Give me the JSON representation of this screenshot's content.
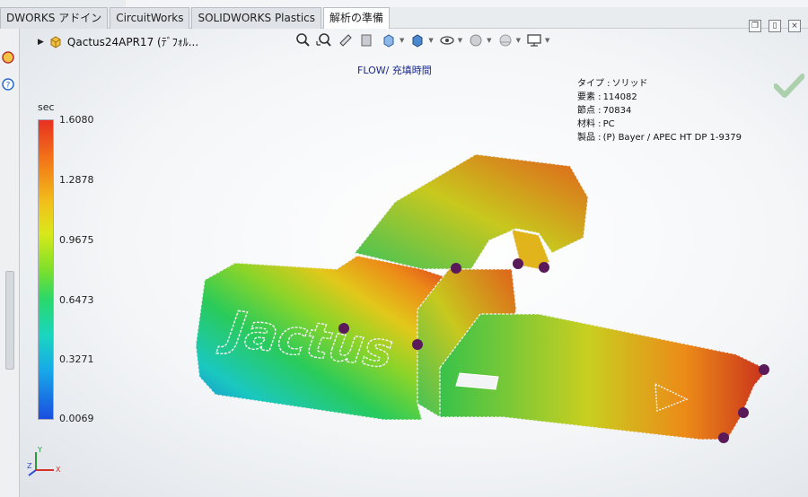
{
  "tabs": [
    {
      "label": "DWORKS アドイン",
      "active": false
    },
    {
      "label": "CircuitWorks",
      "active": false
    },
    {
      "label": "SOLIDWORKS Plastics",
      "active": false
    },
    {
      "label": "解析の準備",
      "active": true
    }
  ],
  "document": {
    "title": "Qactus24APR17 (ﾃﾞﾌｫﾙ..."
  },
  "plot": {
    "title": "FLOW/ 充填時間"
  },
  "info": {
    "type_label": "タイプ :",
    "type_value": "ソリッド",
    "elements_label": "要素 :",
    "elements_value": "114082",
    "nodes_label": "節点 :",
    "nodes_value": "70834",
    "material_label": "材料 :",
    "material_value": "PC",
    "product_label": "製品 :",
    "product_value": "(P)  Bayer / APEC HT DP 1-9379"
  },
  "legend": {
    "unit": "sec",
    "ticks": [
      "1.6080",
      "1.2878",
      "0.9675",
      "0.6473",
      "0.3271",
      "0.0069"
    ],
    "colors": {
      "max": "#e83020",
      "mid": "#7ee02a",
      "min": "#1a4ee0"
    }
  },
  "part": {
    "embossed_text": "Jactus"
  },
  "heads_up_toolbar": [
    "zoom-to-fit-icon",
    "zoom-to-area-icon",
    "previous-view-icon",
    "section-view-icon",
    "view-orientation-icon",
    "display-style-icon",
    "hide-show-items-icon",
    "edit-appearance-icon",
    "apply-scene-icon",
    "view-settings-icon"
  ],
  "triad": {
    "x": "X",
    "y": "Y",
    "z": "Z"
  }
}
